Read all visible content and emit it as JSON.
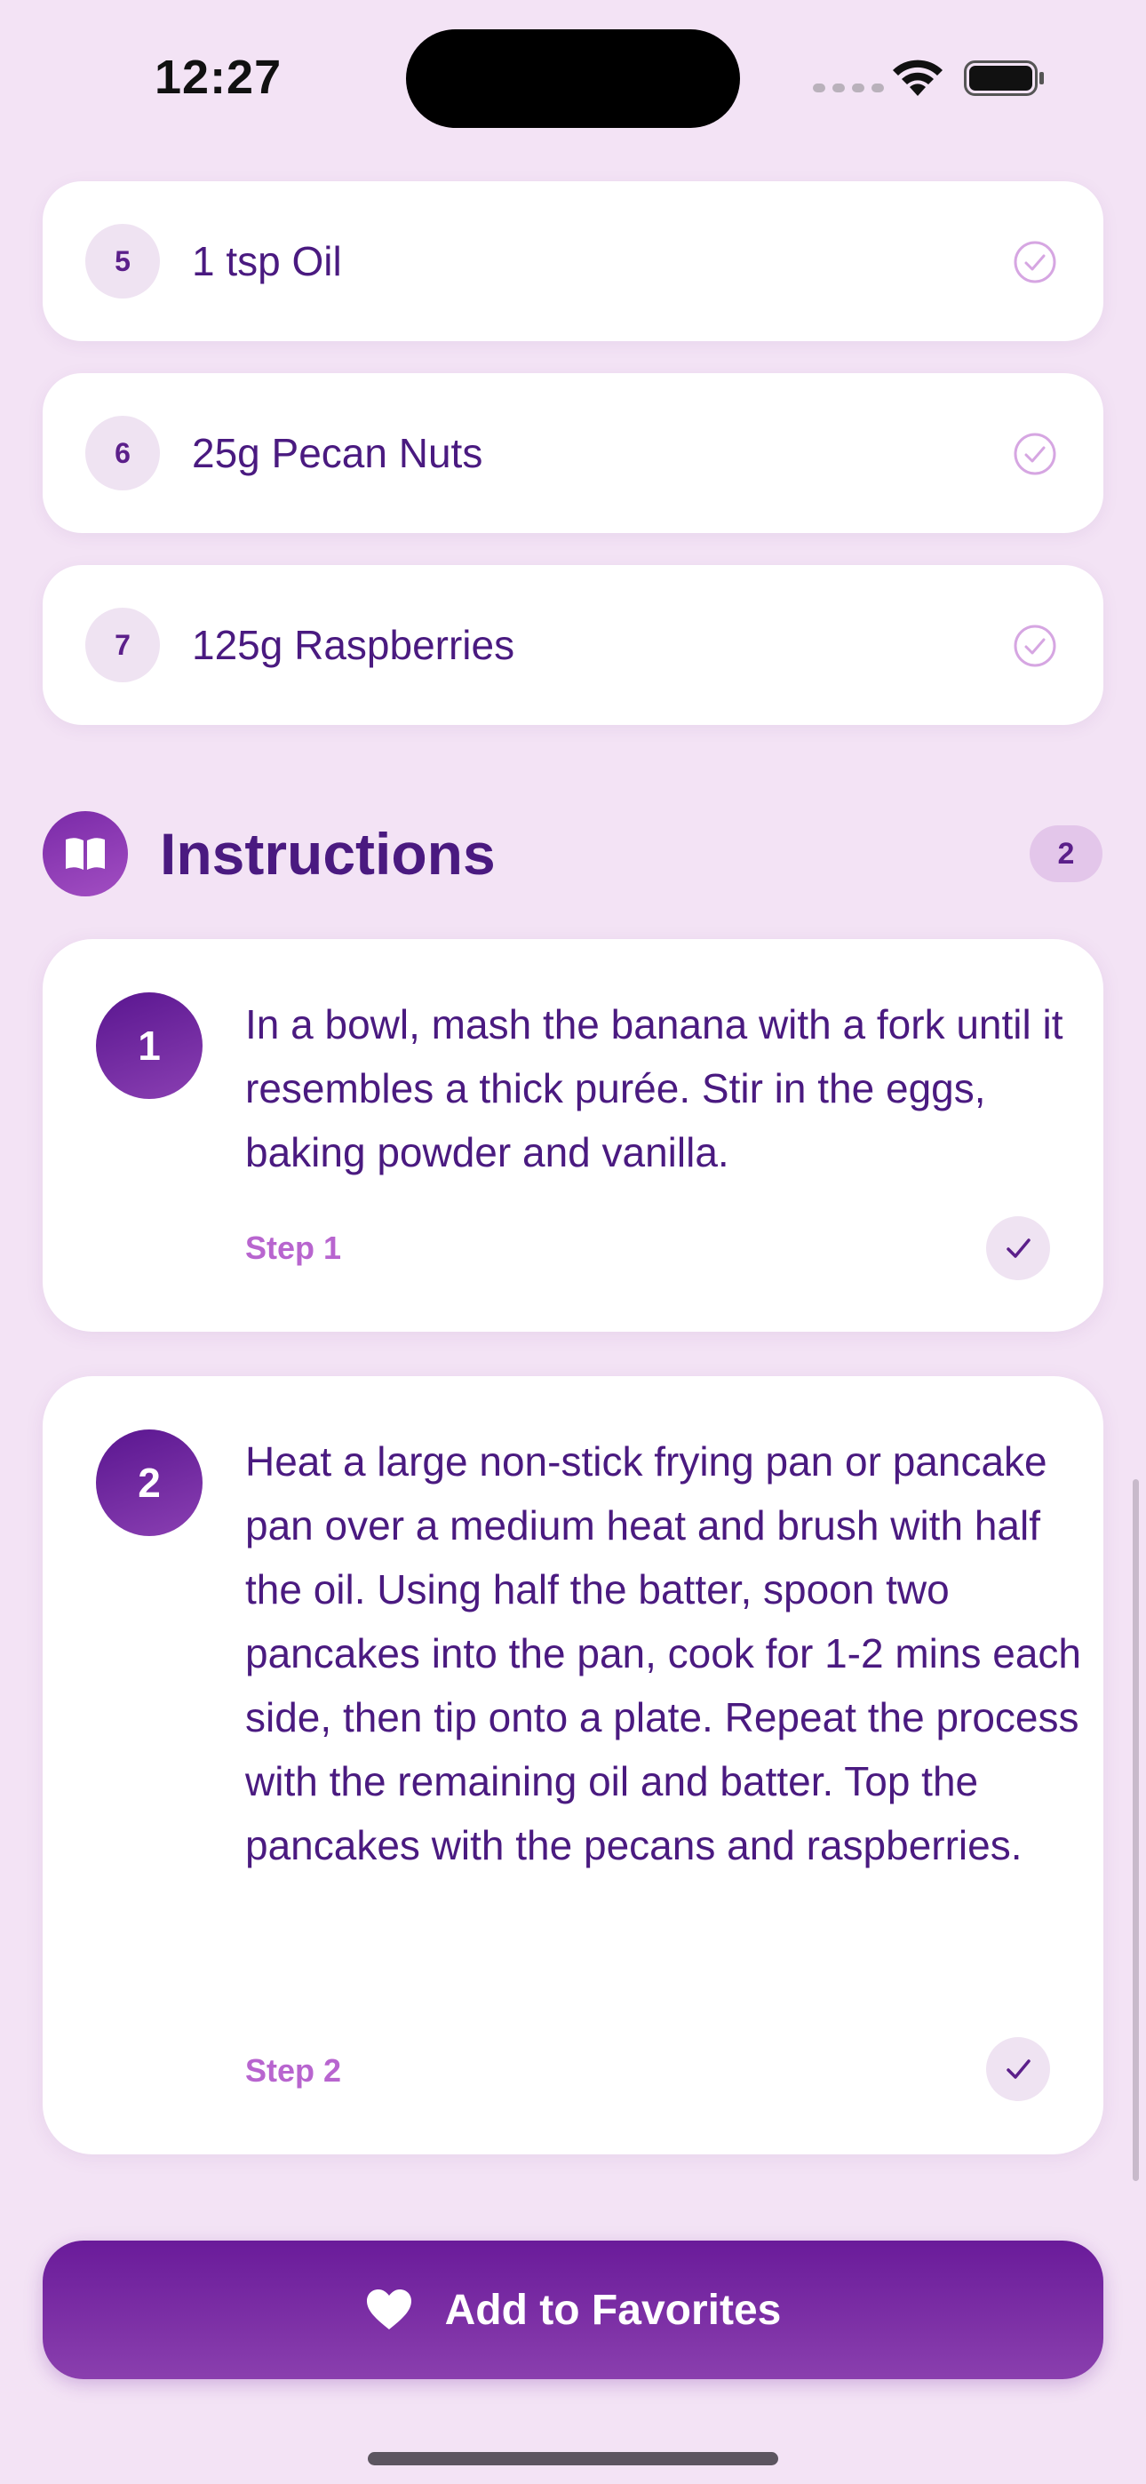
{
  "status_bar": {
    "time": "12:27"
  },
  "ingredients": [
    {
      "number": "5",
      "text": "1 tsp Oil",
      "checked": false
    },
    {
      "number": "6",
      "text": "25g Pecan Nuts",
      "checked": false
    },
    {
      "number": "7",
      "text": "125g Raspberries",
      "checked": false
    }
  ],
  "instructions": {
    "title": "Instructions",
    "count": "2",
    "icon": "book-icon",
    "steps": [
      {
        "number": "1",
        "text": "In a bowl, mash the banana with a fork until it resembles a thick purée. Stir in the eggs, baking powder and vanilla.",
        "label": "Step 1",
        "icon": "checkmark-icon"
      },
      {
        "number": "2",
        "text": "Heat a large non-stick frying pan or pancake pan over a medium heat and brush with half the oil. Using half the batter, spoon two pancakes into the pan, cook for 1-2 mins each side, then tip onto a plate. Repeat the process with the remaining oil and batter. Top the pancakes with the pecans and raspberries.",
        "label": "Step 2",
        "icon": "checkmark-icon"
      }
    ]
  },
  "favorites_button": {
    "label": "Add to Favorites",
    "icon": "heart-icon"
  },
  "colors": {
    "background": "#f3e3f5",
    "primary": "#6a1b9a",
    "text": "#4a1a80",
    "accent_label": "#b865cf"
  }
}
